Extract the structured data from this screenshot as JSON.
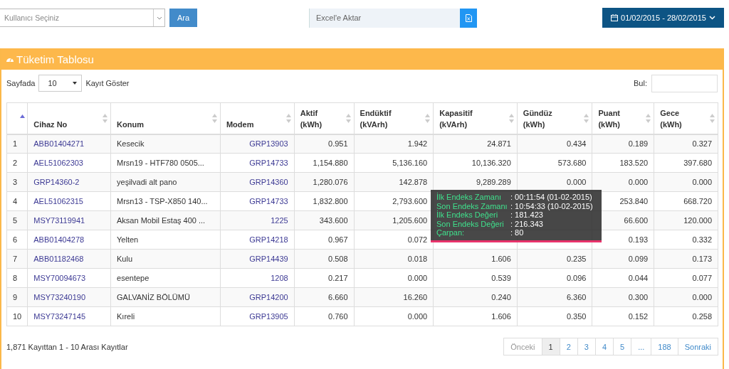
{
  "toolbar": {
    "user_select": {
      "placeholder": "Kullanıcı Seçiniz"
    },
    "search_button": "Ara",
    "export": {
      "placeholder": "Excel'e Aktar"
    },
    "date_range": "01/02/2015 - 28/02/2015"
  },
  "panel": {
    "title": "Tüketim Tablosu",
    "page_size": {
      "before": "Sayfada",
      "value": "10",
      "after": "Kayıt Göster"
    },
    "find": {
      "label": "Bul:"
    },
    "table": {
      "columns": [
        {
          "sorted": true
        },
        {
          "label": "Cihaz No",
          "sorted": false
        },
        {
          "label": "Konum",
          "sorted": false
        },
        {
          "label": "Modem",
          "sorted": false
        },
        {
          "label": "Aktif\n(kWh)",
          "sorted": false
        },
        {
          "label": "Endüktif\n(kVArh)",
          "sorted": false
        },
        {
          "label": "Kapasitif\n(kVArh)",
          "sorted": false
        },
        {
          "label": "Gündüz\n(kWh)",
          "sorted": false
        },
        {
          "label": "Puant\n(kWh)",
          "sorted": false
        },
        {
          "label": "Gece\n(kWh)",
          "sorted": false
        }
      ],
      "rows": [
        [
          "1",
          "ABB01404271",
          "Kesecik",
          "GRP13903",
          "0.951",
          "1.942",
          "24.871",
          "0.434",
          "0.189",
          "0.327"
        ],
        [
          "2",
          "AEL51062303",
          "Mrsn19 - HTF780 0505...",
          "GRP14733",
          "1,154.880",
          "5,136.160",
          "10,136.320",
          "573.680",
          "183.520",
          "397.680"
        ],
        [
          "3",
          "GRP14360-2",
          "yeşilvadi alt pano",
          "GRP14360",
          "1,280.076",
          "142.878",
          "9,289.289",
          "0.000",
          "0.000",
          "0.000"
        ],
        [
          "4",
          "AEL51062315",
          "Mrsn13 - TSP-X850 140...",
          "GRP14733",
          "1,832.800",
          "2,793.600",
          null,
          null,
          "253.840",
          "668.720"
        ],
        [
          "5",
          "MSY73119941",
          "Aksan Mobil Estaş 400 ...",
          "1225",
          "343.600",
          "1,205.600",
          null,
          null,
          "66.600",
          "120.000"
        ],
        [
          "6",
          "ABB01404278",
          "Yelten",
          "GRP14218",
          "0.967",
          "0.072",
          null,
          null,
          "0.193",
          "0.332"
        ],
        [
          "7",
          "ABB01182468",
          "Kulu",
          "GRP14439",
          "0.508",
          "0.018",
          "1.606",
          "0.235",
          "0.099",
          "0.173"
        ],
        [
          "8",
          "MSY70094673",
          "esentepe",
          "1208",
          "0.217",
          "0.000",
          "0.539",
          "0.096",
          "0.044",
          "0.077"
        ],
        [
          "9",
          "MSY73240190",
          "GALVANİZ BÖLÜMÜ",
          "GRP14200",
          "6.660",
          "16.260",
          "0.240",
          "6.360",
          "0.300",
          "0.000"
        ],
        [
          "10",
          "MSY73247145",
          "Kıreli",
          "GRP13905",
          "0.760",
          "0.000",
          "1.606",
          "0.350",
          "0.152",
          "0.258"
        ]
      ]
    },
    "tooltip": [
      {
        "label": "İlk Endeks Zamanı",
        "value": ": 00:11:54 (01-02-2015)"
      },
      {
        "label": "Son Endeks Zamanı",
        "value": ": 10:54:33 (10-02-2015)"
      },
      {
        "label": "İlk Endeks Değeri",
        "value": ": 181.423"
      },
      {
        "label": "Son Endeks Değeri",
        "value": ": 216.343"
      },
      {
        "label": "Çarpan:",
        "value": ": 80"
      }
    ],
    "info": "1,871 Kayıttan 1 - 10 Arası Kayıtlar",
    "pagination": [
      {
        "label": "Önceki",
        "selected": false,
        "disabled": true
      },
      {
        "label": "1",
        "selected": true,
        "disabled": false
      },
      {
        "label": "2",
        "selected": false,
        "disabled": false
      },
      {
        "label": "3",
        "selected": false,
        "disabled": false
      },
      {
        "label": "4",
        "selected": false,
        "disabled": false
      },
      {
        "label": "5",
        "selected": false,
        "disabled": false
      },
      {
        "label": "...",
        "selected": false,
        "disabled": false
      },
      {
        "label": "188",
        "selected": false,
        "disabled": false
      },
      {
        "label": "Sonraki",
        "selected": false,
        "disabled": false
      }
    ]
  }
}
